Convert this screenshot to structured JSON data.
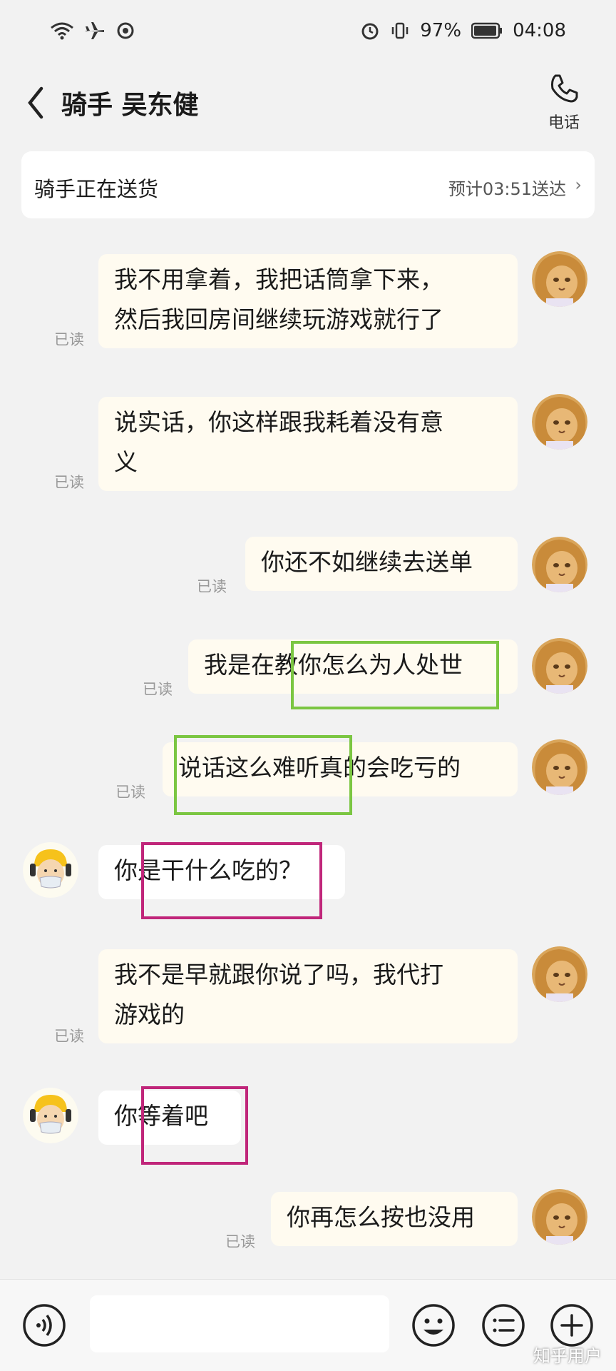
{
  "status_bar": {
    "battery": "97%",
    "time": "04:08"
  },
  "header": {
    "title": "骑手 吴东健",
    "phone_label": "电话"
  },
  "delivery": {
    "status": "骑手正在送货",
    "eta": "预计03:51送达"
  },
  "messages": [
    {
      "side": "self",
      "lines": [
        "我不用拿着，我把话筒拿下来，",
        "然后我回房间继续玩游戏就行了"
      ],
      "read": "已读"
    },
    {
      "side": "self",
      "lines": [
        "说实话，你这样跟我耗着没有意",
        "义"
      ],
      "read": "已读"
    },
    {
      "side": "self",
      "lines": [
        "你还不如继续去送单"
      ],
      "read": "已读"
    },
    {
      "side": "self",
      "lines": [
        "我是在教你怎么为人处世"
      ],
      "read": "已读"
    },
    {
      "side": "self",
      "lines": [
        "说话这么难听真的会吃亏的"
      ],
      "read": "已读"
    },
    {
      "side": "other",
      "lines": [
        "你是干什么吃的？"
      ]
    },
    {
      "side": "self",
      "lines": [
        "我不是早就跟你说了吗，我代打",
        "游戏的"
      ],
      "read": "已读"
    },
    {
      "side": "other",
      "lines": [
        "你等着吧"
      ]
    },
    {
      "side": "self",
      "lines": [
        "你再怎么按也没用"
      ],
      "read": "已读"
    }
  ],
  "input": {
    "placeholder": ""
  },
  "watermark": "知乎用户",
  "colors": {
    "self_bubble": "#fffbf0",
    "other_bubble": "#ffffff",
    "highlight_green": "#7bc642",
    "highlight_pink": "#c0267a"
  }
}
